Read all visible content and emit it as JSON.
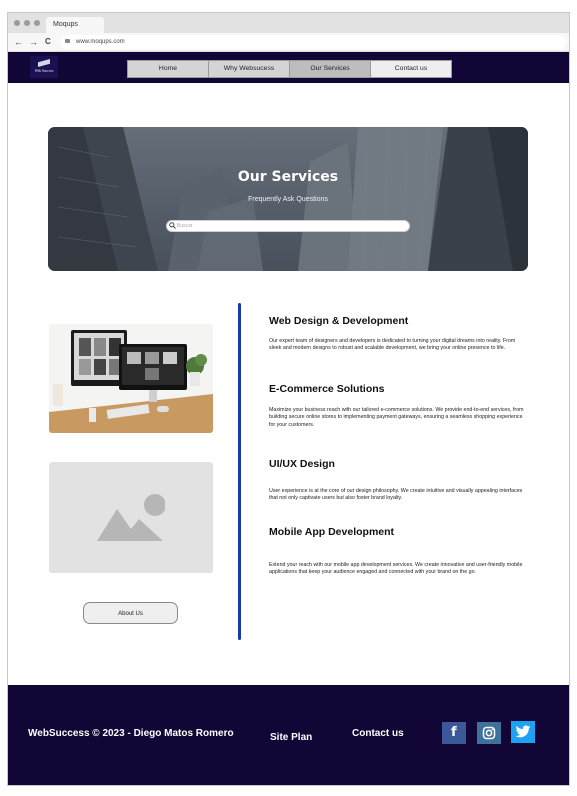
{
  "browser": {
    "tab_title": "Moqups",
    "url": "www.moqups.com",
    "back_glyph": "←",
    "forward_glyph": "→",
    "reload_glyph": "C"
  },
  "header": {
    "logo_text": "Web Success",
    "menu": [
      {
        "label": "Home"
      },
      {
        "label": "Why Websucess"
      },
      {
        "label": "Our Services"
      },
      {
        "label": "Contact us"
      }
    ]
  },
  "hero": {
    "title": "Our Services",
    "subtitle": "Frequently Ask Questions",
    "search_placeholder": "Buscar"
  },
  "left": {
    "about_button": "About Us",
    "image_placeholder_icon": "image-placeholder-icon"
  },
  "services": [
    {
      "title": "Web Design & Development",
      "description": "Our expert team of designers and developers is dedicated to turning your digital dreams into reality. From sleek and modern designs to robust and scalable development, we bring your online presence to life."
    },
    {
      "title": "E-Commerce Solutions",
      "description": "Maximize your business reach with our tailored e-commerce solutions. We provide end-to-end services, from building secure online stores to implementing payment gateways, ensuring a seamless shopping experience for your customers."
    },
    {
      "title": "UI/UX Design",
      "description": "User experience is at the core of our design philosophy. We create intuitive and visually appealing interfaces that not only captivate users but also foster brand loyalty."
    },
    {
      "title": "Mobile App Development",
      "description": "Extend your reach with our mobile app development services. We create innovative and user-friendly mobile applications that keep your audience engaged and connected with your brand on the go."
    }
  ],
  "footer": {
    "copyright": "WebSuccess © 2023 - Diego Matos Romero",
    "site_plan": "Site Plan",
    "contact": "Contact us",
    "social": [
      {
        "name": "facebook-icon",
        "glyph": "f",
        "color": "#3b5998"
      },
      {
        "name": "instagram-icon",
        "color": "#3f729b"
      },
      {
        "name": "twitter-icon",
        "color": "#1da1f2"
      }
    ]
  },
  "colors": {
    "header_bg": "#120637",
    "footer_bg": "#120637",
    "divider": "#1638a8",
    "hero_overlay": "#5f6873"
  }
}
